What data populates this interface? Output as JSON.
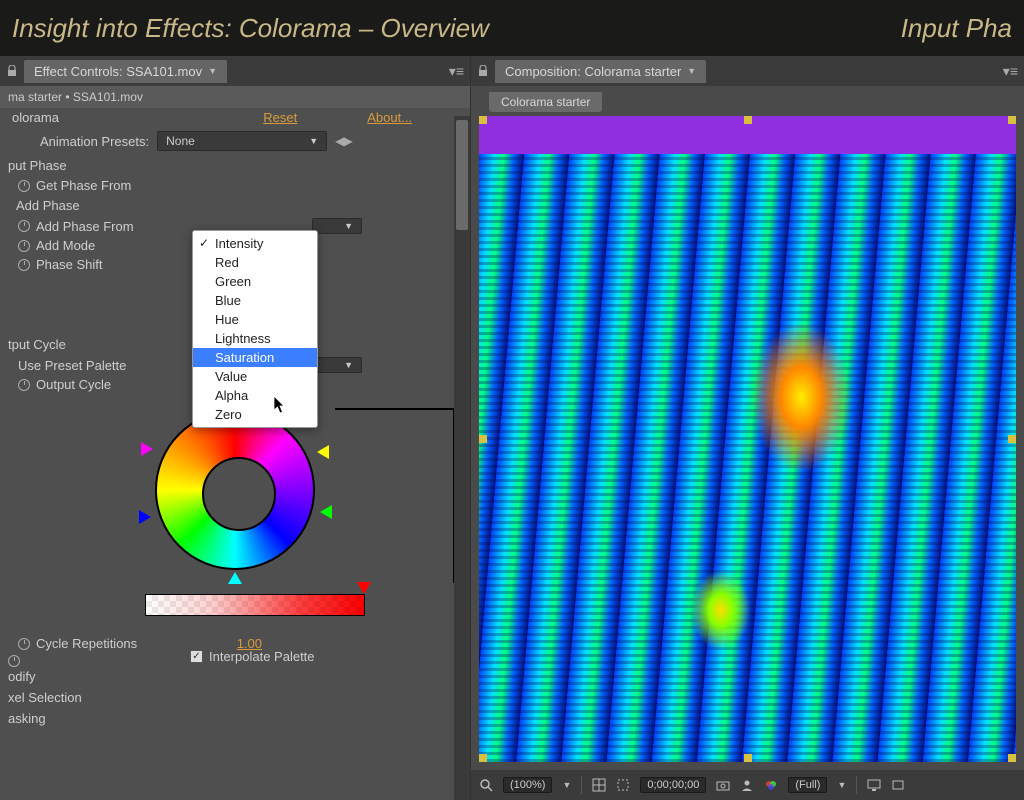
{
  "titlebar": {
    "title": "Insight into Effects: Colorama – Overview",
    "right": "Input Pha"
  },
  "effect_controls": {
    "tab_label": "Effect Controls: SSA101.mov",
    "subheader": "ma starter • SSA101.mov",
    "effect_name": "olorama",
    "reset": "Reset",
    "about": "About...",
    "presets_label": "Animation Presets:",
    "presets_value": "None",
    "sections": {
      "input_phase": "put Phase",
      "get_phase_from": "Get Phase From",
      "add_phase": "Add Phase",
      "add_phase_from": "Add Phase From",
      "add_mode": "Add Mode",
      "phase_shift": "Phase Shift",
      "output_cycle": "tput Cycle",
      "use_preset_palette": "Use Preset Palette",
      "output_cycle_row": "Output Cycle",
      "cycle_repetitions": "Cycle Repetitions",
      "cycle_rep_value": "1.00",
      "interpolate": "Interpolate Palette",
      "modify": "odify",
      "pixel_selection": "xel Selection",
      "masking": "asking"
    },
    "dropdown_options": [
      {
        "label": "Intensity",
        "checked": true,
        "highlight": false
      },
      {
        "label": "Red",
        "checked": false,
        "highlight": false
      },
      {
        "label": "Green",
        "checked": false,
        "highlight": false
      },
      {
        "label": "Blue",
        "checked": false,
        "highlight": false
      },
      {
        "label": "Hue",
        "checked": false,
        "highlight": false
      },
      {
        "label": "Lightness",
        "checked": false,
        "highlight": false
      },
      {
        "label": "Saturation",
        "checked": false,
        "highlight": true
      },
      {
        "label": "Value",
        "checked": false,
        "highlight": false
      },
      {
        "label": "Alpha",
        "checked": false,
        "highlight": false
      },
      {
        "label": "Zero",
        "checked": false,
        "highlight": false
      }
    ]
  },
  "composition": {
    "tab_label": "Composition: Colorama starter",
    "comp_name": "Colorama starter",
    "footer": {
      "zoom": "(100%)",
      "timecode": "0;00;00;00",
      "resolution": "(Full)"
    }
  }
}
